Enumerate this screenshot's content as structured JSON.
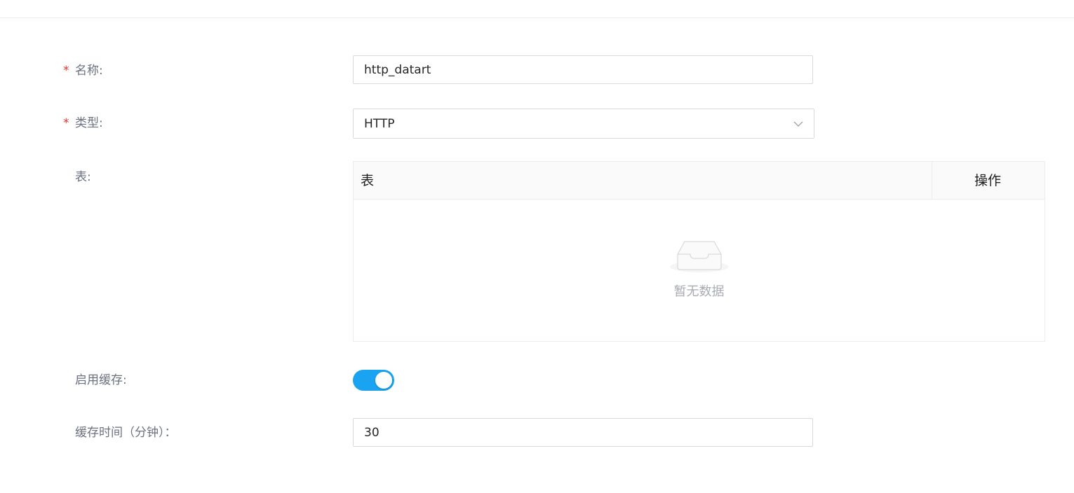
{
  "form": {
    "name": {
      "required_mark": "*",
      "label": "名称:",
      "value": "http_datart"
    },
    "type": {
      "required_mark": "*",
      "label": "类型:",
      "selected": "HTTP",
      "arrow_icon": "chevron-down-icon"
    },
    "tables": {
      "label": "表:",
      "columns": [
        "表",
        "操作"
      ],
      "rows": [],
      "empty_icon": "empty-inbox-icon",
      "empty_text": "暂无数据"
    },
    "cache_enabled": {
      "label": "启用缓存:",
      "on": true,
      "color": "#1aa3f0"
    },
    "cache_time": {
      "label": "缓存时间（分钟）：",
      "value": "30"
    }
  },
  "colors": {
    "required": "#e5332f",
    "label": "#6b7180",
    "accent": "#1aa3f0",
    "empty_text": "#a8abb4"
  }
}
